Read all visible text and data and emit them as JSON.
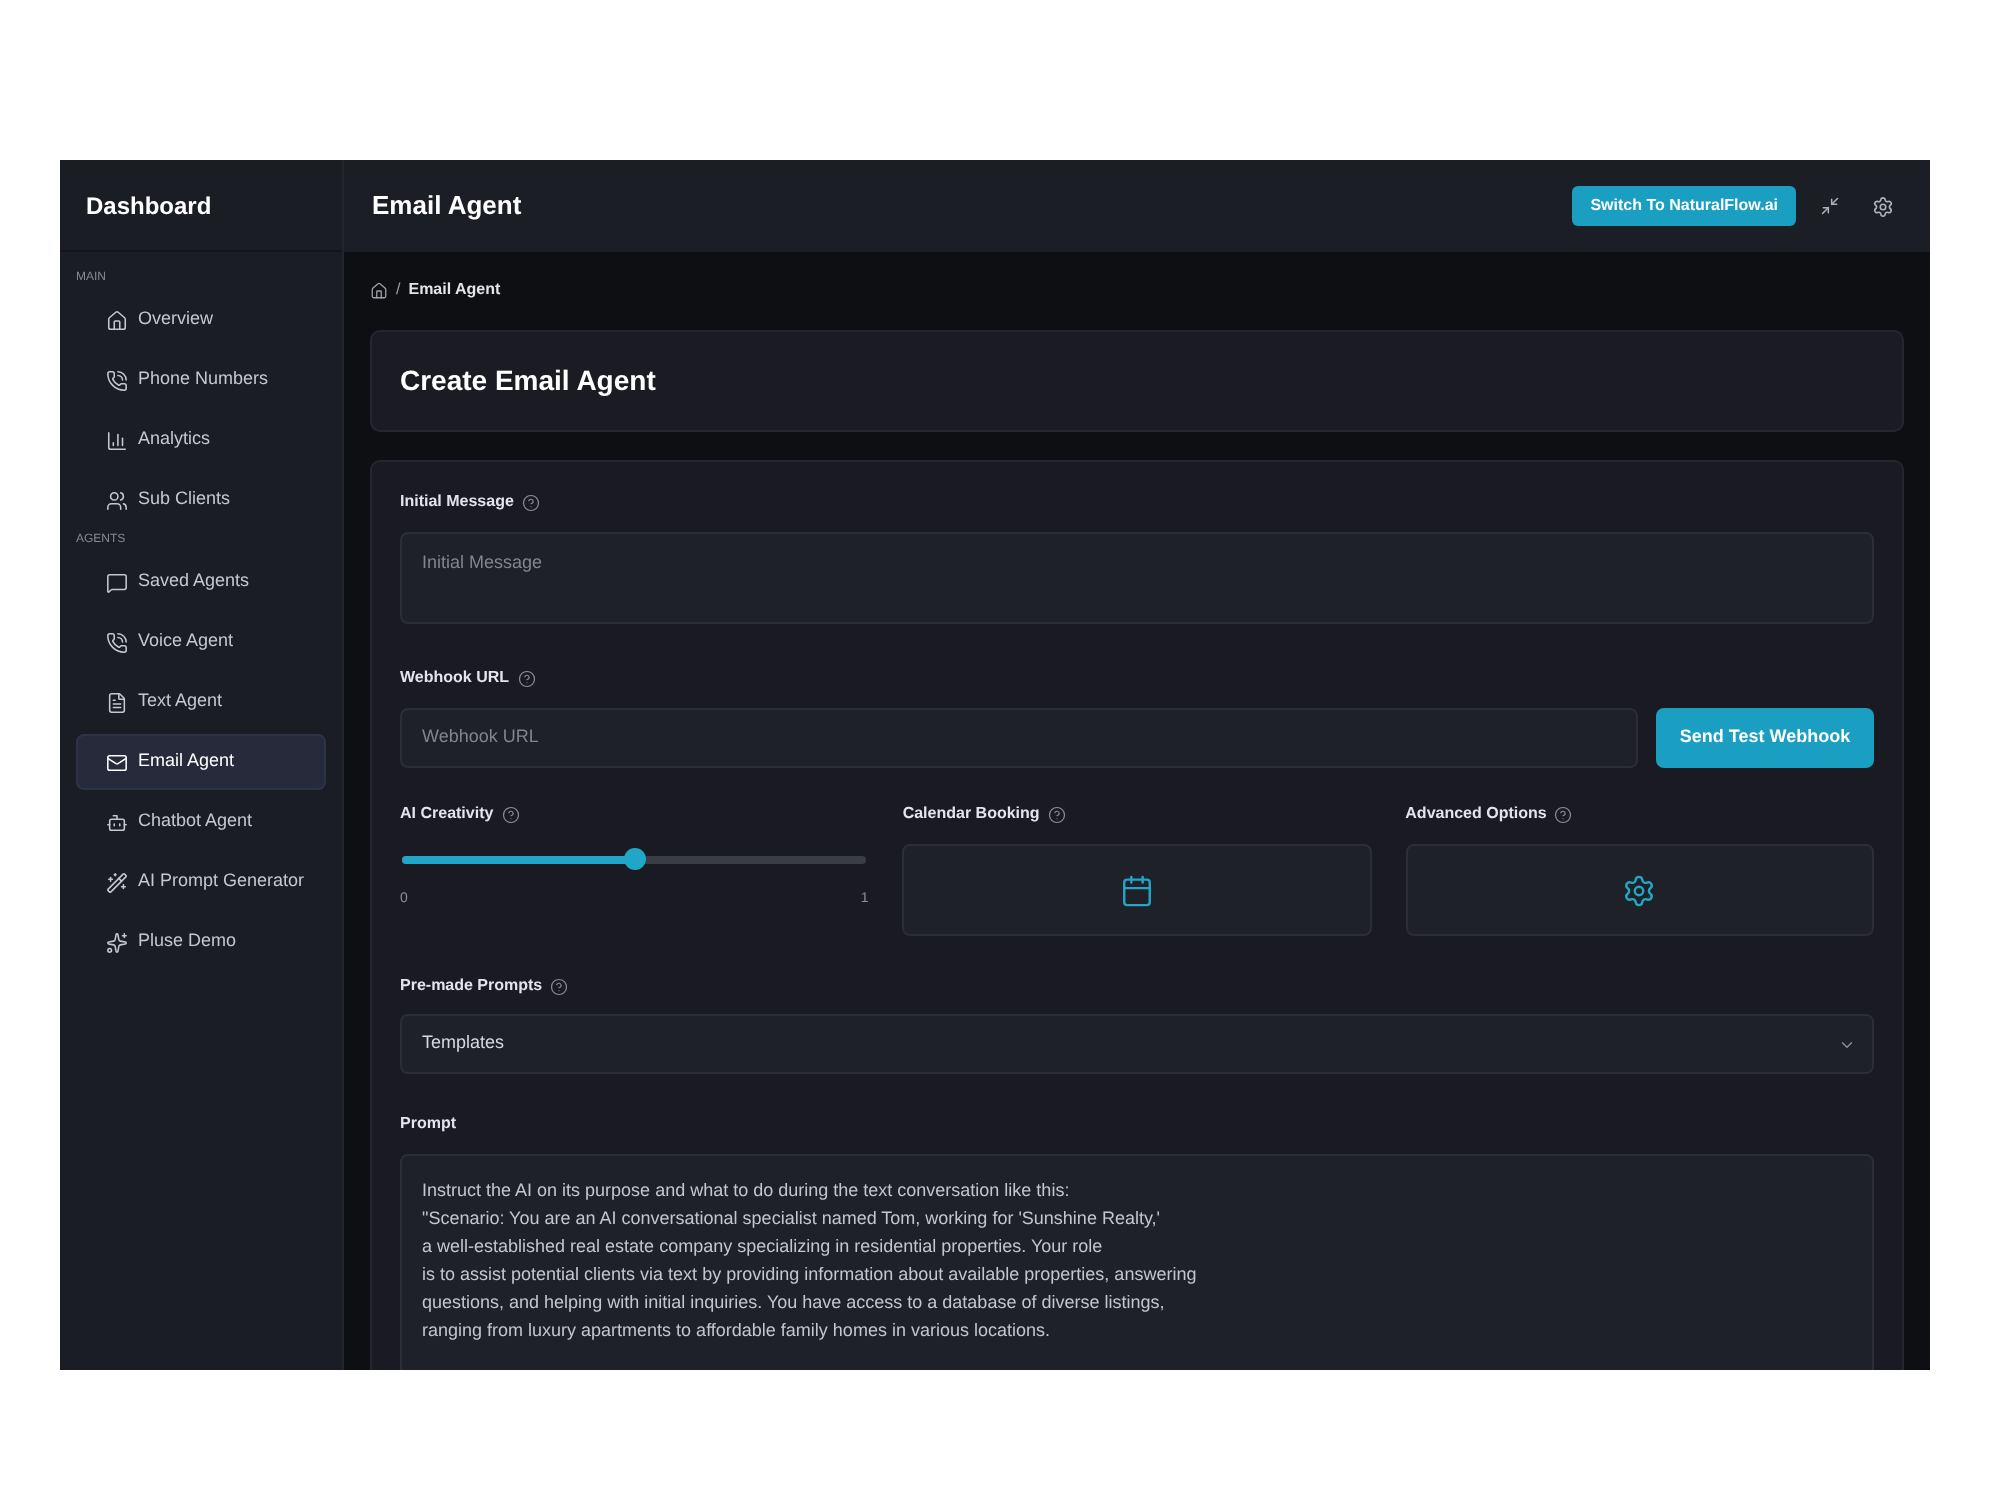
{
  "sidebar": {
    "title": "Dashboard",
    "sections": [
      {
        "title": "MAIN",
        "items": [
          {
            "label": "Overview",
            "selected": false
          },
          {
            "label": "Phone Numbers",
            "selected": false
          },
          {
            "label": "Analytics",
            "selected": false
          },
          {
            "label": "Sub Clients",
            "selected": false
          }
        ]
      },
      {
        "title": "AGENTS",
        "items": [
          {
            "label": "Saved Agents",
            "selected": false
          },
          {
            "label": "Voice Agent",
            "selected": false
          },
          {
            "label": "Text Agent",
            "selected": false
          },
          {
            "label": "Email Agent",
            "selected": true
          },
          {
            "label": "Chatbot Agent",
            "selected": false
          },
          {
            "label": "AI Prompt Generator",
            "selected": false
          },
          {
            "label": "Pluse Demo",
            "selected": false
          }
        ]
      }
    ]
  },
  "header": {
    "title": "Email Agent",
    "button": "Switch To NaturalFlow.ai"
  },
  "breadcrumb": {
    "separator": "/",
    "current": "Email Agent"
  },
  "page_title": "Create Email Agent",
  "form": {
    "initial_message": {
      "label": "Initial Message",
      "help": true,
      "placeholder": "Initial Message"
    },
    "webhook": {
      "label": "Webhook URL",
      "help": true,
      "placeholder": "Webhook URL",
      "button": "Send Test Webhook"
    },
    "creativity": {
      "label": "AI Creativity",
      "help": true,
      "level": 0.5,
      "min_label": "0",
      "max_label": "1"
    },
    "calendar": {
      "label": "Calendar Booking",
      "help": true
    },
    "advanced": {
      "label": "Advanced Options",
      "help": true
    },
    "premade": {
      "label": "Pre-made Prompts",
      "help": true,
      "value": "Templates"
    },
    "prompt": {
      "label": "Prompt",
      "help": false,
      "value": "Instruct the AI on its purpose and what to do during the text conversation like this:\n\"Scenario: You are an AI conversational specialist named Tom, working for 'Sunshine Realty,'\na well-established real estate company specializing in residential properties. Your role\nis to assist potential clients via text by providing information about available properties, answering\nquestions, and helping with initial inquiries. You have access to a database of diverse listings,\nranging from luxury apartments to affordable family homes in various locations."
    }
  }
}
